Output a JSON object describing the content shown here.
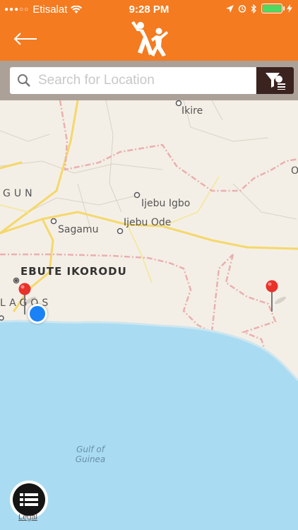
{
  "status_bar": {
    "carrier": "Etisalat",
    "time": "9:28 PM",
    "signal_icon": "signal-dots-icon",
    "wifi_icon": "wifi-icon",
    "battery_level": 1.0,
    "battery_color": "#4cd964"
  },
  "nav": {
    "back_icon": "arrow-left-icon",
    "logo_icon": "two-figures-logo-icon",
    "brand_color": "#f47b20"
  },
  "search": {
    "placeholder": "Search for Location",
    "value": "",
    "filter_icon": "filter-list-icon"
  },
  "map": {
    "places": [
      {
        "name": "Ikire",
        "style": "town"
      },
      {
        "name": "Ijebu Igbo",
        "style": "town"
      },
      {
        "name": "Sagamu",
        "style": "town"
      },
      {
        "name": "Ijebu Ode",
        "style": "town"
      },
      {
        "name": "EBUTE IKORODU",
        "style": "city"
      },
      {
        "name": "LAGOS",
        "style": "region"
      },
      {
        "name": "GUN",
        "style": "region"
      },
      {
        "name": "O",
        "style": "region"
      }
    ],
    "water_label": "Gulf of\nGuinea",
    "pins": [
      {
        "name": "pin-lagos",
        "color": "#e8322a"
      },
      {
        "name": "pin-east",
        "color": "#e8322a"
      }
    ],
    "user_location_color": "#1a82f7",
    "land_color": "#f4efe6",
    "water_color": "#a9dcf3",
    "road_color": "#f5d86b"
  },
  "controls": {
    "list_icon": "list-view-icon",
    "legal_label": "Legal"
  }
}
